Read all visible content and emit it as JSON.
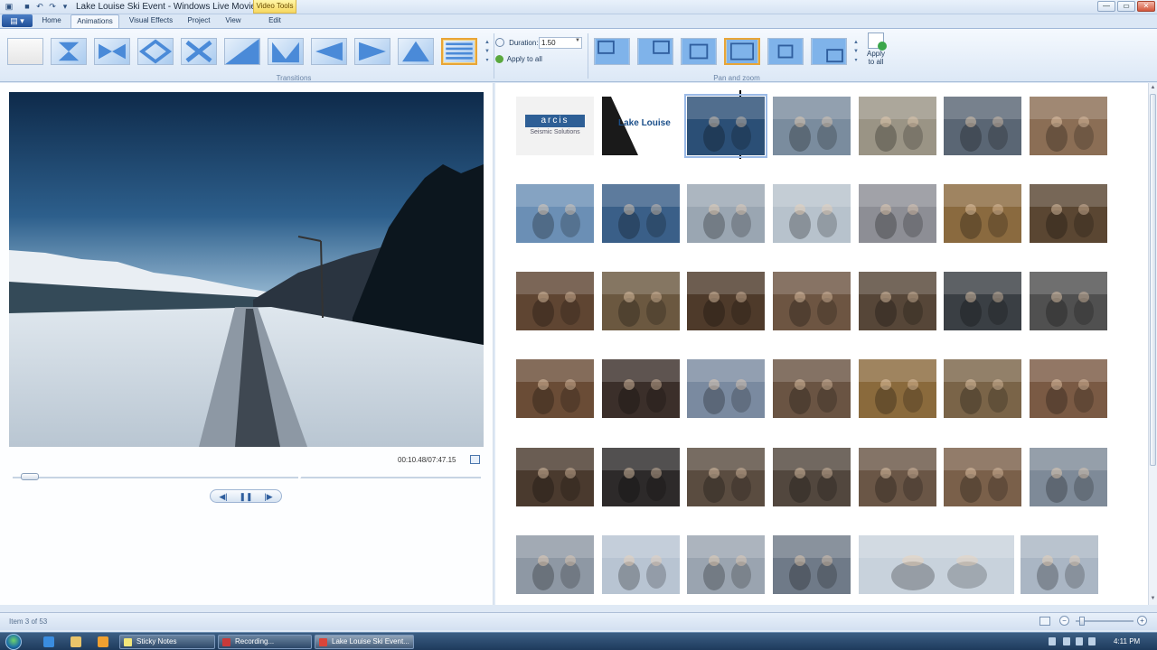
{
  "window": {
    "title": "Lake Louise Ski Event - Windows Live Movie Maker",
    "context_tab": "Video Tools",
    "qat_icons": [
      "save-icon",
      "undo-icon",
      "redo-icon",
      "customize-icon"
    ],
    "controls": {
      "minimize": "—",
      "maximize": "▭",
      "close": "✕"
    }
  },
  "menu": {
    "app_button": "▤ ▾",
    "tabs": [
      "Home",
      "Animations",
      "Visual Effects",
      "Project",
      "View",
      "Edit"
    ],
    "active_tab": "Animations"
  },
  "ribbon": {
    "transitions_label": "Transitions",
    "panzoom_label": "Pan and zoom",
    "duration_label": "Duration:",
    "duration_value": "1.50",
    "apply_to_all": "Apply to all",
    "apply_to_all_button": "Apply to all",
    "transition_icons": [
      "none-icon",
      "hourglass-icon",
      "bowtie-icon",
      "diamond-icon",
      "cross-icon",
      "diagonal-up-icon",
      "chevron-down-icon",
      "arrow-left-icon",
      "arrow-right-icon",
      "triangle-up-icon",
      "horizontal-lines-icon"
    ],
    "selected_transition": 10,
    "panzoom_icons": [
      "pan-topleft-icon",
      "pan-topright-icon",
      "zoom-in-icon",
      "zoom-out-icon",
      "pan-center-icon",
      "pan-bottomright-icon"
    ],
    "selected_panzoom": 3
  },
  "preview": {
    "timecode": "00:10.48/07:47.15",
    "progress_fraction": 0.022,
    "controls": {
      "previous": "◀|",
      "pause": "❚❚",
      "next": "|▶"
    }
  },
  "storyboard": {
    "selected_index": 2,
    "title_slide_company": "arcis",
    "title_slide_tagline": "Seismic Solutions",
    "title_slide_event": "Lake Louise",
    "clip_colors": [
      [
        "#f2f2f2",
        "#1a1a1a",
        "#2b4f76",
        "#7a8c9e",
        "#9a9485",
        "#5a6674",
        "#8b6e55"
      ],
      [
        "#6b8fb5",
        "#3a5f88",
        "#9aa6b2",
        "#b7c2cc",
        "#8d8e95",
        "#8a6a3f",
        "#5a4632"
      ],
      [
        "#5f4532",
        "#6b5840",
        "#4e3a2a",
        "#6d5542",
        "#564638",
        "#3a3f44",
        "#505050"
      ],
      [
        "#6a4c36",
        "#3b2f2a",
        "#7a8aa0",
        "#6a5443",
        "#8a6a3c",
        "#7a6448",
        "#7a5a44"
      ],
      [
        "#4a3a2e",
        "#2d2a2a",
        "#5a4c40",
        "#52473e",
        "#6a5646",
        "#7a604a",
        "#7e8a98"
      ],
      [
        "#8e98a4",
        "#b8c4d2",
        "#9aa4b0",
        "#6f7a88",
        "#c8d2dc",
        "#aab6c4"
      ]
    ]
  },
  "status": {
    "item_text": "Item 3 of 53",
    "zoom_fraction": 0.06
  },
  "taskbar": {
    "tasks": [
      "Sticky Notes",
      "Recording...",
      "Lake Louise Ski Event..."
    ],
    "clock": "4:11 PM"
  }
}
